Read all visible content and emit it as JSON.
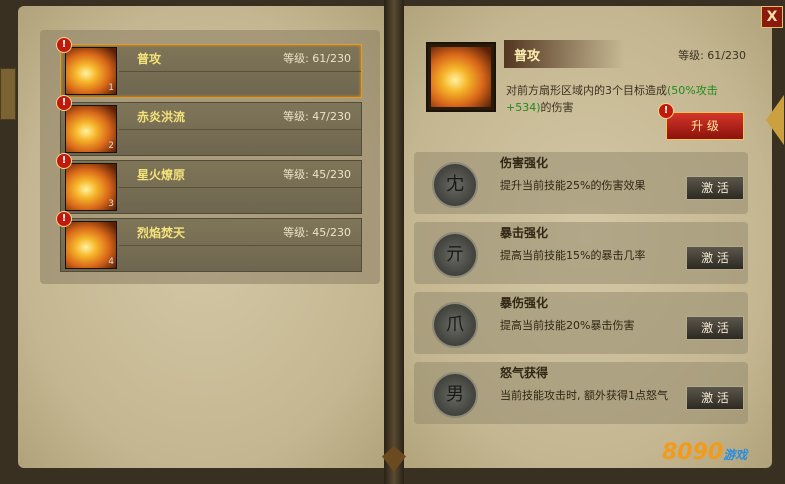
{
  "window": {
    "close_label": "X"
  },
  "skills": [
    {
      "name": "普攻",
      "level_text": "等级: 61/230",
      "slot": "1",
      "selected": true,
      "alert": "!"
    },
    {
      "name": "赤炎洪流",
      "level_text": "等级: 47/230",
      "slot": "2",
      "selected": false,
      "alert": "!"
    },
    {
      "name": "星火燎原",
      "level_text": "等级: 45/230",
      "slot": "3",
      "selected": false,
      "alert": "!"
    },
    {
      "name": "烈焰焚天",
      "level_text": "等级: 45/230",
      "slot": "4",
      "selected": false,
      "alert": "!"
    }
  ],
  "detail": {
    "title": "普攻",
    "level_text": "等级: 61/230",
    "desc_pre": "对前方扇形区域内的",
    "desc_target": "3个",
    "desc_mid": "目标造成",
    "desc_dmg": "(50%攻击+534)",
    "desc_post": "的伤害",
    "upgrade_label": "升 级",
    "alert": "!"
  },
  "perks": [
    {
      "title": "伤害强化",
      "desc": "提升当前技能25%的伤害效果",
      "button": "激 活",
      "glyph": "冘"
    },
    {
      "title": "暴击强化",
      "desc": "提高当前技能15%的暴击几率",
      "button": "激 活",
      "glyph": "亓"
    },
    {
      "title": "暴伤强化",
      "desc": "提高当前技能20%暴击伤害",
      "button": "激 活",
      "glyph": "爪"
    },
    {
      "title": "怒气获得",
      "desc": "当前技能攻击时, 额外获得1点怒气",
      "button": "激 活",
      "glyph": "男"
    }
  ],
  "logo": {
    "main": "8090",
    "sub": "游戏"
  },
  "colors": {
    "accent": "#e59a25",
    "skill_name": "#f3e37a",
    "highlight": "#1f8a1f",
    "upgrade": "#d5352a"
  }
}
